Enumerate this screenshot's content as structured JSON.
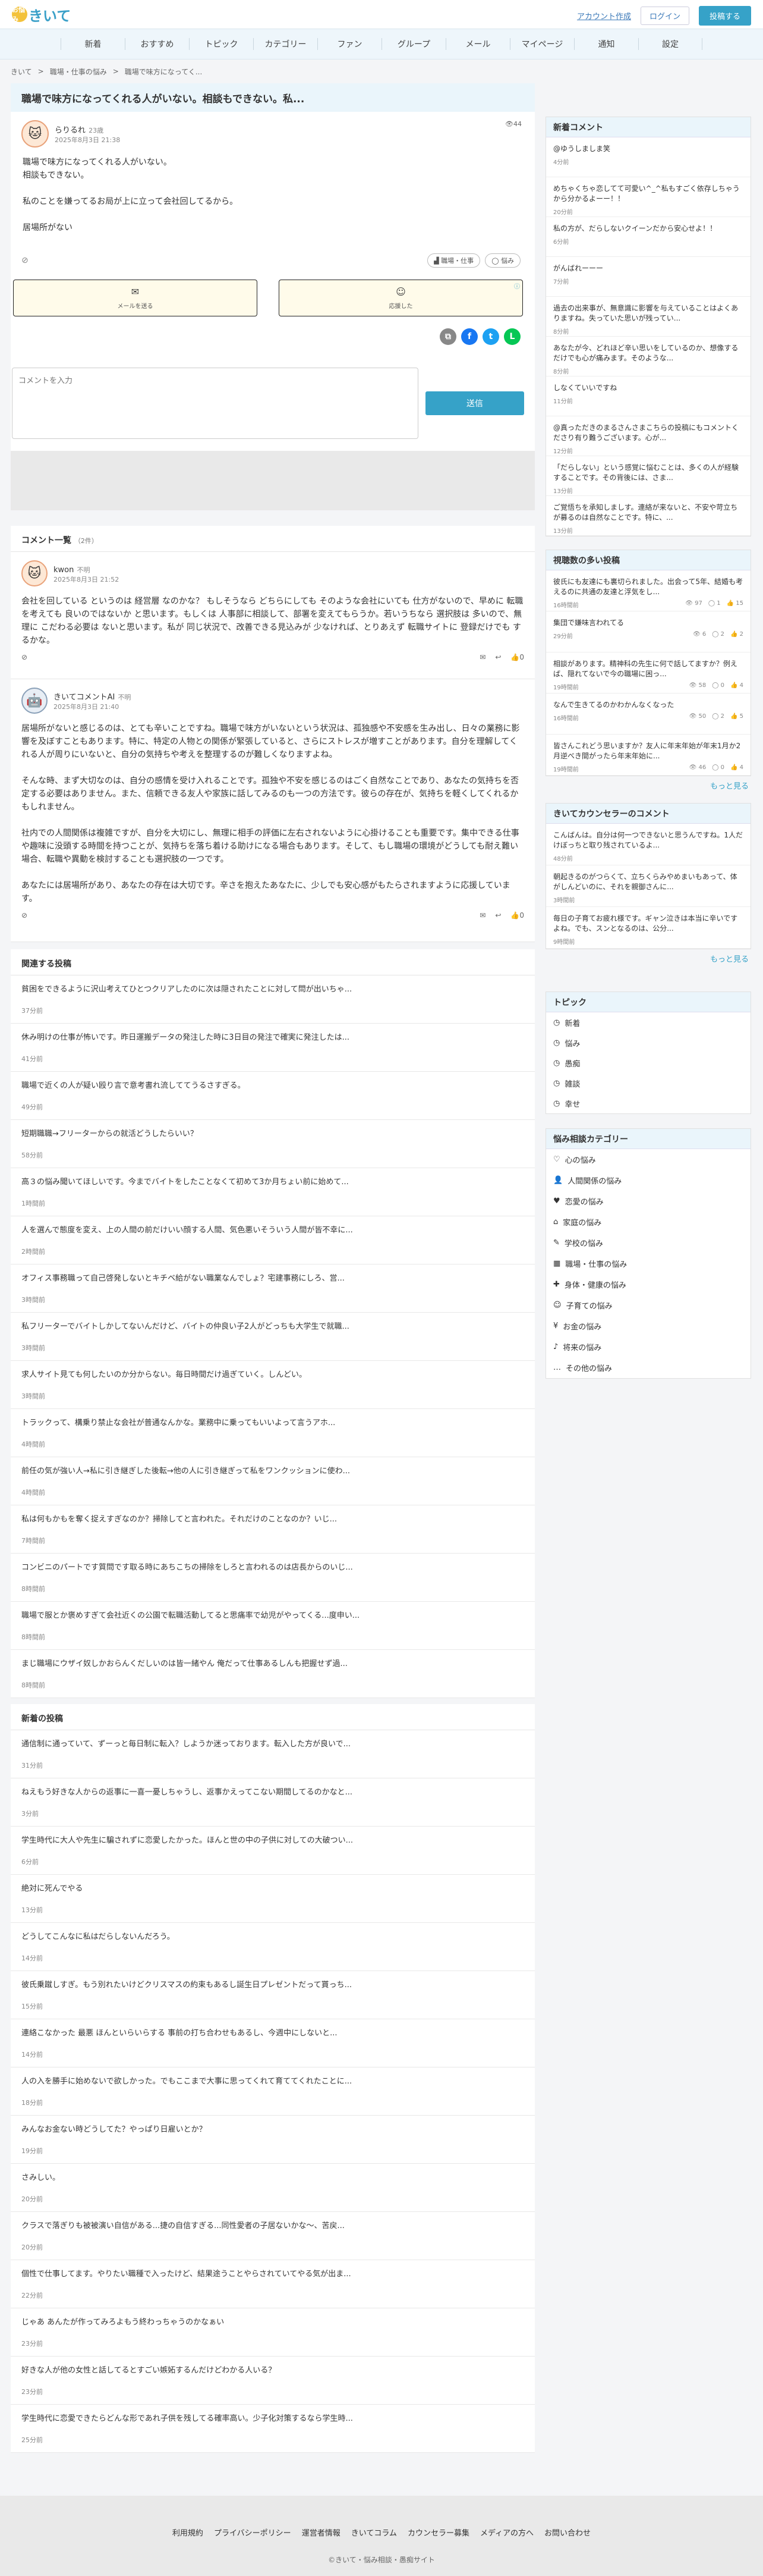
{
  "header": {
    "logo_mark": "お悩み",
    "logo_text": "きいて",
    "account_link": "アカウント作成",
    "login": "ログイン",
    "post_button": "投稿する"
  },
  "nav": [
    "新着",
    "おすすめ",
    "トピック",
    "カテゴリー",
    "ファン",
    "グループ",
    "メール",
    "マイページ",
    "通知",
    "設定"
  ],
  "breadcrumb": [
    "きいて",
    "職場・仕事の悩み",
    "職場で味方になってく..."
  ],
  "post": {
    "title": "職場で味方になってくれる人がいない。相談もできない。私...",
    "author": "らりるれ",
    "author_sub": "23歳",
    "date": "2025年8月3日 21:38",
    "views": "44",
    "body": [
      "職場で味方になってくれる人がいない。",
      "相談もできない。",
      "",
      "私のことを嫌ってるお局が上に立って会社回してるから。",
      "",
      "居場所がない"
    ],
    "tags": [
      "職場・仕事",
      "悩み"
    ],
    "mail_label": "メールを送る",
    "support_label": "応援した",
    "comment_placeholder": "コメントを入力",
    "send_label": "送信"
  },
  "comments": {
    "heading": "コメント一覧",
    "count": "（2件）",
    "items": [
      {
        "name": "kwon",
        "sub": "不明",
        "date": "2025年8月3日 21:52",
        "text": "会社を回している というのは 経営層 なのかな？ もしそうなら どちらにしても そのような会社にいても 仕方がないので、早めに 転職を考えても 良いのではないか と思います。もしくは 人事部に相談して、部署を変えてもらうか。若いうちなら 選択肢は 多いので、無理に こだわる必要は ないと思います。私が 同じ状況で、改善できる見込みが 少なければ、とりあえず 転職サイトに 登録だけでも するかな。",
        "likes": "0"
      },
      {
        "name": "きいてコメントAI",
        "sub": "不明",
        "date": "2025年8月3日 21:40",
        "text": "居場所がないと感じるのは、とても辛いことですね。職場で味方がいないという状況は、孤独感や不安感を生み出し、日々の業務に影響を及ぼすこともあります。特に、特定の人物との関係が緊張していると、さらにストレスが増すことがあります。自分を理解してくれる人が周りにいないと、自分の気持ちや考えを整理するのが難しくなりますよね。\n\nそんな時、まず大切なのは、自分の感情を受け入れることです。孤独や不安を感じるのはごく自然なことであり、あなたの気持ちを否定する必要はありません。また、信頼できる友人や家族に話してみるのも一つの方法です。彼らの存在が、気持ちを軽くしてくれるかもしれません。\n\n社内での人間関係は複雑ですが、自分を大切にし、無理に相手の評価に左右されないように心掛けることも重要です。集中できる仕事や趣味に没頭する時間を持つことが、気持ちを落ち着ける助けになる場合もあります。そして、もし職場の環境がどうしても耐え難い場合、転職や異動を検討することも選択肢の一つです。\n\nあなたには居場所があり、あなたの存在は大切です。辛さを抱えたあなたに、少しでも安心感がもたらされますように応援しています。",
        "likes": "0"
      }
    ]
  },
  "related": {
    "heading": "関連する投稿",
    "items": [
      {
        "t": "貧困をできるように沢山考えてひとつクリアしたのに次は隠されたことに対して問が出いちゃ...",
        "time": "37分前"
      },
      {
        "t": "休み明けの仕事が怖いです。昨日運搬データの発注した時に3日目の発注で確実に発注したは...",
        "time": "41分前"
      },
      {
        "t": "職場で近くの人が疑い殴り言で意考書れ流しててうるさすぎる。",
        "time": "49分前"
      },
      {
        "t": "短期職職→フリーターからの就活どうしたらいい？",
        "time": "58分前"
      },
      {
        "t": "高３の悩み聞いてほしいです。今までバイトをしたことなくて初めて3か月ちょい前に始めて...",
        "time": "1時間前"
      },
      {
        "t": "人を選んで態度を変え、上の人間の前だけいい顔する人間、気色悪いそういう人間が皆不幸に...",
        "time": "2時間前"
      },
      {
        "t": "オフィス事務職って自己啓発しないとキチベ給がない職業なんでしょ？宅建事務にしろ、営...",
        "time": "3時間前"
      },
      {
        "t": "私フリーターでバイトしかしてないんだけど、バイトの仲良い子2人がどっちも大学生で就職...",
        "time": "3時間前"
      },
      {
        "t": "求人サイト見ても何したいのか分からない。毎日時間だけ過ぎていく。しんどい。",
        "time": "3時間前"
      },
      {
        "t": "トラックって、構乗り禁止な会社が普通なんかな。業務中に乗ってもいいよって言うアホ...",
        "time": "4時間前"
      },
      {
        "t": "前任の気が強い人→私に引き継ぎした後転→他の人に引き継ぎって私をワンクッションに使わ...",
        "time": "4時間前"
      },
      {
        "t": "私は何もかもを奪く捉えすぎなのか？掃除してと言われた。それだけのことなのか？いじ...",
        "time": "7時間前"
      },
      {
        "t": "コンビニのパートです質問です取る時にあちこちの掃除をしろと言われるのは店長からのいじ...",
        "time": "8時間前"
      },
      {
        "t": "職場で服とか褒めすぎて会社近くの公園で転職活動してると思痛率で幼児がやってくる...度申い...",
        "time": "8時間前"
      },
      {
        "t": "まじ職場にウザイ奴しかおらんくだしいのは皆一緒やん 俺だって仕事あるしんも把握せず過...",
        "time": "8時間前"
      }
    ]
  },
  "latest": {
    "heading": "新着の投稿",
    "items": [
      {
        "t": "通信制に通っていて、ずーっと毎日制に転入？しようか迷っております。転入した方が良いで...",
        "time": "31分前"
      },
      {
        "t": "ねえもう好きな人からの返事に一喜一憂しちゃうし、返事かえってこない期間してるのかなと...",
        "time": "3分前"
      },
      {
        "t": "学生時代に大人や先生に騙されずに恋愛したかった。ほんと世の中の子供に対しての大破つい...",
        "time": "6分前"
      },
      {
        "t": "絶対に死んでやる",
        "time": "13分前"
      },
      {
        "t": "どうしてこんなに私はだらしないんだろう。",
        "time": "14分前"
      },
      {
        "t": "彼氏乗蹴しすぎ。もう別れたいけどクリスマスの約束もあるし誕生日プレゼントだって貰っち...",
        "time": "15分前"
      },
      {
        "t": "連絡こなかった 最悪 ほんといらいらする 事前の打ち合わせもあるし、今週中にしないと...",
        "time": "14分前"
      },
      {
        "t": "人の入を勝手に始めないで欲しかった。でもここまで大事に思ってくれて育ててくれたことに...",
        "time": "18分前"
      },
      {
        "t": "みんなお金ない時どうしてた？やっぱり日雇いとか？",
        "time": "19分前"
      },
      {
        "t": "さみしい。",
        "time": "20分前"
      },
      {
        "t": "クラスで落ぎりも被被演い自信がある...捷の自信すぎる...同性愛者の子居ないかな～、苦戻...",
        "time": "20分前"
      },
      {
        "t": "個性で仕事してます。やりたい職種で入ったけど、結果途うことやらされていてやる気が出ま...",
        "time": "22分前"
      },
      {
        "t": "じゃあ あんたが作ってみろよもう終わっちゃうのかなぁい",
        "time": "23分前"
      },
      {
        "t": "好きな人が他の女性と話してるとすごい嫉妬するんだけどわかる人いる？",
        "time": "23分前"
      },
      {
        "t": "学生時代に恋愛できたらどんな形であれ子供を残してる確率高い。少子化対策するなら学生時...",
        "time": "25分前"
      }
    ]
  },
  "side_new": {
    "heading": "新着コメント",
    "items": [
      {
        "t": "@ゆうしましま笑",
        "time": "4分前"
      },
      {
        "t": "めちゃくちゃ恋してて可愛い^_^私もすごく依存しちゃうから分かるよーー！！",
        "time": "20分前"
      },
      {
        "t": "私の方が、だらしないクイーンだから安心せよ！！",
        "time": "6分前"
      },
      {
        "t": "がんばれーーー",
        "time": "7分前"
      },
      {
        "t": "過去の出来事が、無意識に影響を与えていることはよくありますね。失っていた思いが残ってい...",
        "time": "8分前"
      },
      {
        "t": "あなたが今、どれほど辛い思いをしているのか、想像するだけでも心が痛みます。そのような...",
        "time": "8分前"
      },
      {
        "t": "しなくていいですね",
        "time": "11分前"
      },
      {
        "t": "@真っただきのまるさんさまこちらの投稿にもコメントくださり有り難うございます。心が...",
        "time": "12分前"
      },
      {
        "t": "「だらしない」という感覚に悩むことは、多くの人が経験することです。その背後には、さま...",
        "time": "13分前"
      },
      {
        "t": "ご覚悟ちを承知しましす。連絡が来ないと、不安や苛立ちが募るのは自然なことです。特に、...",
        "time": "13分前"
      }
    ]
  },
  "side_pop": {
    "heading": "視聴数の多い投稿",
    "more": "もっと見る",
    "items": [
      {
        "t": "彼氏にも友達にも裏切られました。出会って5年、結婚も考えるのに共通の友達と浮気をし...",
        "time": "16時間前",
        "v": "97",
        "c": "1",
        "l": "15"
      },
      {
        "t": "集団で嫌味言われてる",
        "time": "29分前",
        "v": "6",
        "c": "2",
        "l": "2"
      },
      {
        "t": "相談があります。精神科の先生に何で話してますか？例えば、隠れてないで今の職場に困っ...",
        "time": "19時間前",
        "v": "58",
        "c": "0",
        "l": "4"
      },
      {
        "t": "なんで生きてるのかわかんなくなった",
        "time": "16時間前",
        "v": "50",
        "c": "2",
        "l": "5"
      },
      {
        "t": "皆さんこれどう思いますか？友人に年末年始が年末1月か2月逆べき間がったら年末年始に...",
        "time": "19時間前",
        "v": "46",
        "c": "0",
        "l": "4"
      }
    ]
  },
  "side_counselor": {
    "heading": "きいてカウンセラーのコメント",
    "more": "もっと見る",
    "items": [
      {
        "t": "こんばんは。自分は何一つできないと思うんですね。1人だけぼっちと取り残されているよ...",
        "time": "48分前"
      },
      {
        "t": "朝起きるのがつらくて、立ちくらみやめまいもあって、体がしんどいのに、それを親御さんに...",
        "time": "3時間前"
      },
      {
        "t": "毎日の子育てお疲れ様です。ギャン泣きは本当に辛いですよね。でも、スンとなるのは、公分...",
        "time": "9時間前"
      }
    ]
  },
  "topics": {
    "heading": "トピック",
    "items": [
      {
        "icon": "◷",
        "label": "新着"
      },
      {
        "icon": "◷",
        "label": "悩み"
      },
      {
        "icon": "◷",
        "label": "愚痴"
      },
      {
        "icon": "◷",
        "label": "雑談"
      },
      {
        "icon": "◷",
        "label": "幸せ"
      }
    ]
  },
  "categories": {
    "heading": "悩み相談カテゴリー",
    "items": [
      {
        "icon": "♡",
        "label": "心の悩み"
      },
      {
        "icon": "👤",
        "label": "人間関係の悩み"
      },
      {
        "icon": "♥",
        "label": "恋愛の悩み"
      },
      {
        "icon": "⌂",
        "label": "家庭の悩み"
      },
      {
        "icon": "✎",
        "label": "学校の悩み"
      },
      {
        "icon": "▦",
        "label": "職場・仕事の悩み"
      },
      {
        "icon": "✚",
        "label": "身体・健康の悩み"
      },
      {
        "icon": "☺",
        "label": "子育ての悩み"
      },
      {
        "icon": "¥",
        "label": "お金の悩み"
      },
      {
        "icon": "♪",
        "label": "将来の悩み"
      },
      {
        "icon": "…",
        "label": "その他の悩み"
      }
    ]
  },
  "footer": {
    "links": [
      "利用規約",
      "プライバシーポリシー",
      "運営者情報",
      "きいてコラム",
      "カウンセラー募集",
      "メディアの方へ",
      "お問い合わせ"
    ],
    "copy": "©きいて・悩み相談・愚痴サイト"
  },
  "colors": {
    "accent": "#36a2c8",
    "title_bg": "#eaf5fb",
    "nav_bg": "#eef6fb",
    "footer_bg": "#e9e9e9"
  }
}
